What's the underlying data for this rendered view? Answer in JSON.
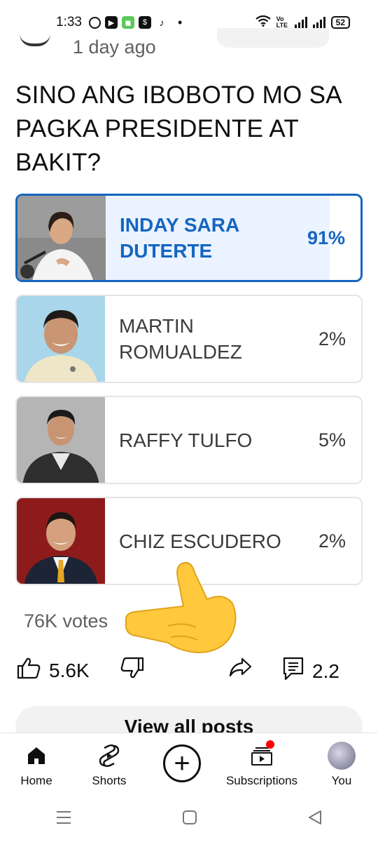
{
  "status_bar": {
    "time": "1:33",
    "battery": "52",
    "network_label": "Vo LTE"
  },
  "post": {
    "time_ago": "1 day ago",
    "question": "SINO ANG IBOBOTO MO SA PAGKA PRESIDENTE AT BAKIT?"
  },
  "poll": {
    "options": [
      {
        "label": "INDAY SARA DUTERTE",
        "percent": "91%",
        "value": 91,
        "selected": true,
        "photo": "person-photo-1"
      },
      {
        "label": "MARTIN ROMUALDEZ",
        "percent": "2%",
        "value": 2,
        "selected": false,
        "photo": "person-photo-2"
      },
      {
        "label": "RAFFY TULFO",
        "percent": "5%",
        "value": 5,
        "selected": false,
        "photo": "person-photo-3"
      },
      {
        "label": "CHIZ ESCUDERO",
        "percent": "2%",
        "value": 2,
        "selected": false,
        "photo": "person-photo-4"
      }
    ],
    "votes": "76K votes",
    "accent_color": "#1565c0"
  },
  "actions": {
    "likes": "5.6K",
    "comments": "2.2",
    "like_icon": "thumbs-up-icon",
    "dislike_icon": "thumbs-down-icon",
    "share_icon": "share-icon",
    "comment_icon": "comment-icon"
  },
  "view_all": "View all posts",
  "bottom_nav": {
    "home": "Home",
    "shorts": "Shorts",
    "subscriptions": "Subscriptions",
    "you": "You"
  }
}
